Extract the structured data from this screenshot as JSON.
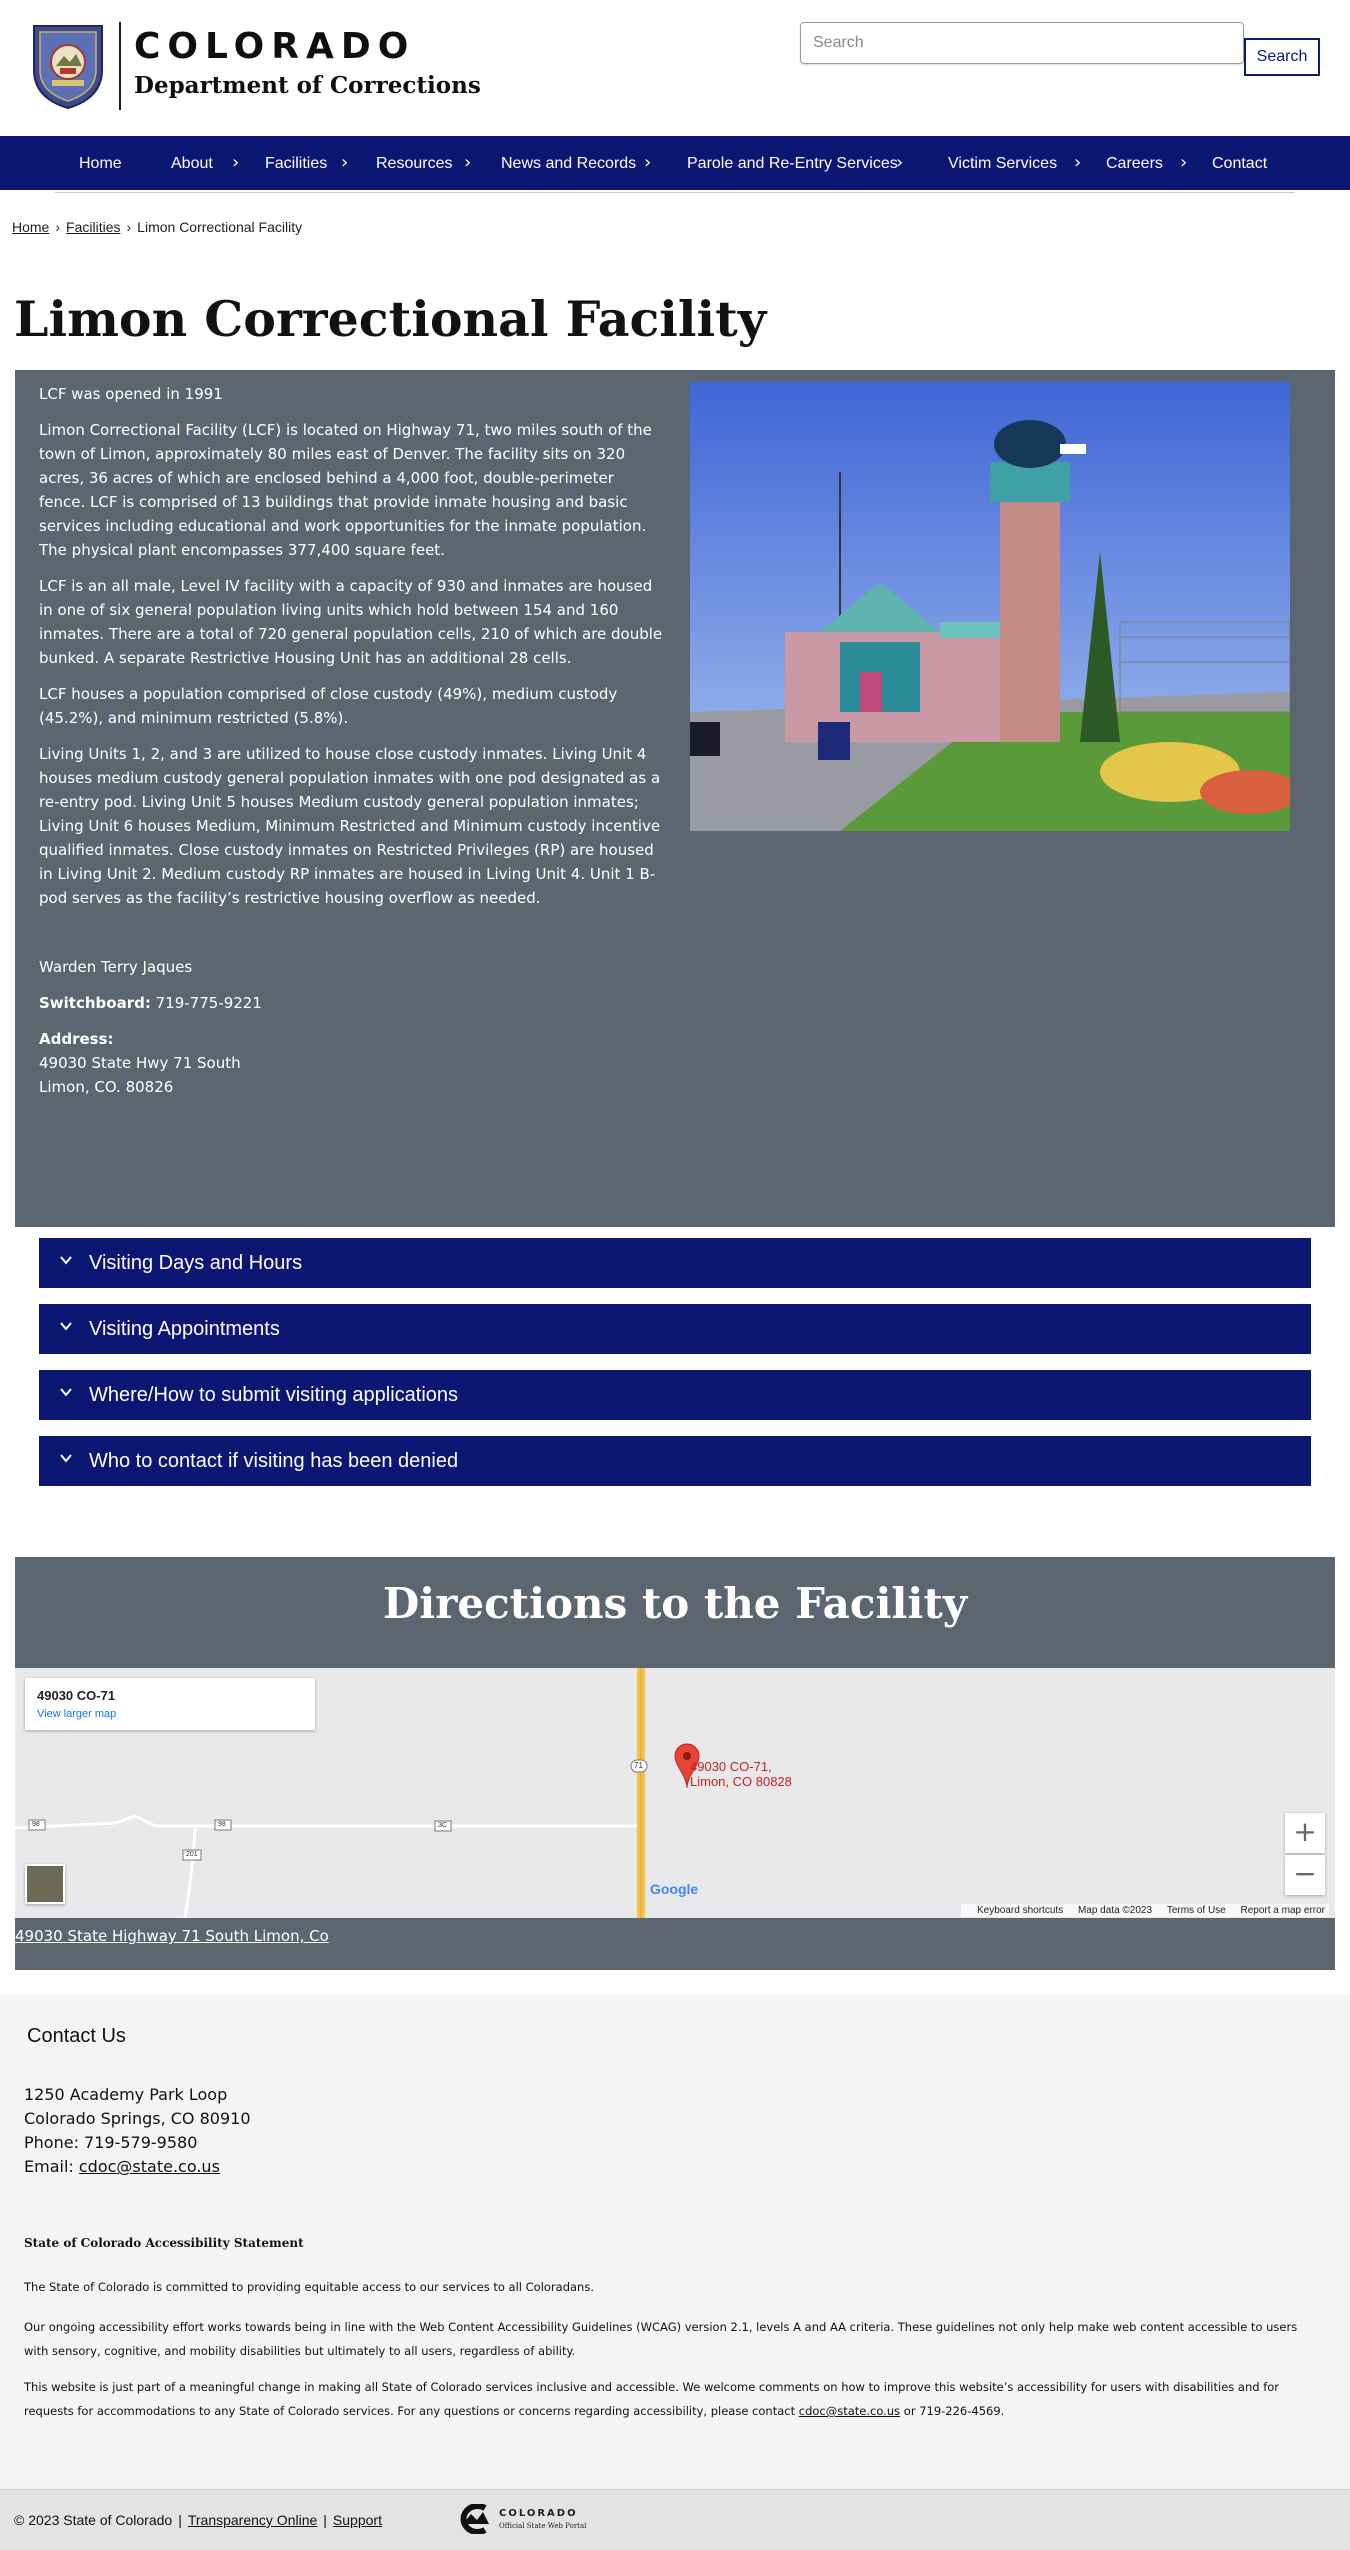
{
  "header": {
    "brand_title": "COLORADO",
    "brand_subtitle": "Department of Corrections",
    "search_placeholder": "Search",
    "search_button": "Search"
  },
  "nav": {
    "items": [
      {
        "label": "Home",
        "has_submenu": false
      },
      {
        "label": "About",
        "has_submenu": true
      },
      {
        "label": "Facilities",
        "has_submenu": true
      },
      {
        "label": "Resources",
        "has_submenu": true
      },
      {
        "label": "News and Records",
        "has_submenu": true
      },
      {
        "label": "Parole and Re-Entry Services",
        "has_submenu": true
      },
      {
        "label": "Victim Services",
        "has_submenu": true
      },
      {
        "label": "Careers",
        "has_submenu": true
      },
      {
        "label": "Contact",
        "has_submenu": false
      }
    ],
    "chevron": "›"
  },
  "breadcrumb": {
    "home": "Home",
    "facilities": "Facilities",
    "current": "Limon Correctional Facility",
    "separator": "›"
  },
  "page_title": "Limon Correctional Facility",
  "info": {
    "paragraphs": [
      "LCF was opened in 1991",
      "Limon Correctional Facility (LCF) is located on Highway 71, two miles south of the town of Limon, approximately 80 miles east of Denver. The facility sits on 320 acres, 36 acres of which are enclosed behind a 4,000 foot, double-perimeter fence.  LCF is comprised of 13 buildings that provide inmate housing and basic services including educational and work opportunities for the inmate population. The physical plant encompasses 377,400 square feet.",
      "LCF is an all male, Level IV facility with a capacity of 930 and inmates are housed in one of six general population living units which hold between 154 and 160 inmates. There are a total of 720 general population cells, 210 of which are double bunked. A separate Restrictive Housing Unit has an additional 28 cells.",
      "LCF houses a population comprised of close custody (49%), medium custody (45.2%), and minimum restricted (5.8%).",
      "Living Units 1, 2, and 3 are utilized to house close custody inmates. Living Unit 4 houses medium custody general population inmates with one pod designated as a re-entry pod. Living Unit 5 houses Medium custody general population inmates; Living Unit 6 houses Medium, Minimum Restricted and Minimum custody incentive qualified inmates.  Close custody inmates on Restricted Privileges (RP) are housed in Living Unit 2. Medium custody RP inmates are housed in Living Unit 4. Unit 1 B-pod serves as the facility’s restrictive housing overflow as needed."
    ],
    "warden": "Warden Terry Jaques",
    "switchboard_label": "Switchboard:",
    "switchboard_value": " 719-775-9221",
    "address_label": "Address:",
    "address_line1": "49030 State Hwy 71 South",
    "address_line2": "Limon, CO. 80826"
  },
  "accordion": [
    {
      "label": "Visiting Days and Hours"
    },
    {
      "label": "Visiting Appointments"
    },
    {
      "label": "Where/How to submit visiting applications"
    },
    {
      "label": "Who to contact if visiting has been denied"
    }
  ],
  "directions": {
    "title": "Directions to the Facility",
    "map_card_address": "49030 CO-71",
    "map_card_link": "View larger map",
    "pin_line1": "49030 CO-71,",
    "pin_line2": "Limon, CO 80828",
    "road_labels": [
      "71",
      "98",
      "98",
      "3C",
      "201"
    ],
    "zoom_in": "+",
    "zoom_out": "−",
    "google": "Google",
    "map_footer": [
      "Keyboard shortcuts",
      "Map data ©2023",
      "Terms of Use",
      "Report a map error"
    ],
    "link": "49030 State Highway 71 South Limon, Co"
  },
  "footer": {
    "heading": "Contact Us",
    "address_line1": "1250 Academy Park Loop",
    "address_line2": "Colorado Springs, CO 80910",
    "phone": "Phone: 719-579-9580",
    "email_label": "Email: ",
    "email": "cdoc@state.co.us",
    "accessibility_heading": "State of Colorado Accessibility Statement",
    "acc_p1": "The State of Colorado is committed to providing equitable access to our services to all Coloradans.",
    "acc_p2": "Our ongoing accessibility effort works towards being in line with the Web Content Accessibility Guidelines (WCAG) version 2.1, levels A and AA criteria. These guidelines not only help make web content accessible to users with sensory, cognitive, and mobility disabilities but ultimately to all users, regardless of ability.",
    "acc_p3_before": "This website is just part of a meaningful change in making all State of Colorado services inclusive and accessible. We welcome comments on how to improve this website’s accessibility for users with disabilities and for requests for accommodations to any State of Colorado services. For any questions or concerns regarding accessibility, please contact ",
    "acc_p3_email": "cdoc@state.co.us",
    "acc_p3_after": " or 719-226-4569."
  },
  "bottom": {
    "copyright": "© 2023 State of Colorado",
    "separator": "|",
    "transparency": "Transparency Online",
    "support": "Support",
    "portal_title": "COLORADO",
    "portal_sub": "Official State Web Portal"
  },
  "colors": {
    "nav_blue": "#0b1773",
    "panel_gray": "#5c6670",
    "footer_bg": "#f4f4f4",
    "bottom_bar": "#e3e3e3",
    "pin_red": "#ea4335"
  }
}
